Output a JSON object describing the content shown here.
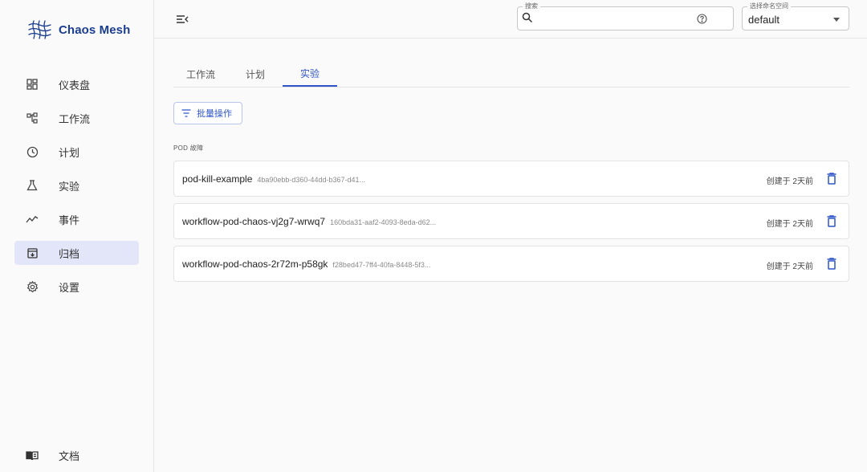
{
  "app": {
    "name": "Chaos Mesh"
  },
  "sidebar": {
    "items": [
      {
        "label": "仪表盘",
        "icon": "dashboard-icon"
      },
      {
        "label": "工作流",
        "icon": "workflow-icon"
      },
      {
        "label": "计划",
        "icon": "schedule-icon"
      },
      {
        "label": "实验",
        "icon": "experiment-icon"
      },
      {
        "label": "事件",
        "icon": "events-icon"
      },
      {
        "label": "归档",
        "icon": "archive-icon",
        "active": true
      },
      {
        "label": "设置",
        "icon": "settings-icon"
      }
    ],
    "docs": {
      "label": "文档",
      "icon": "docs-icon"
    }
  },
  "topbar": {
    "search": {
      "legend": "搜索",
      "placeholder": ""
    },
    "namespace": {
      "legend": "选择命名空间",
      "value": "default"
    }
  },
  "tabs": [
    {
      "label": "工作流"
    },
    {
      "label": "计划"
    },
    {
      "label": "实验",
      "active": true
    }
  ],
  "batch_button": {
    "label": "批量操作"
  },
  "section": {
    "title": "POD 故障"
  },
  "rows": [
    {
      "name": "pod-kill-example",
      "uid": "4ba90ebb-d360-44dd-b367-d41...",
      "created": "创建于 2天前"
    },
    {
      "name": "workflow-pod-chaos-vj2g7-wrwq7",
      "uid": "160bda31-aaf2-4093-8eda-d62...",
      "created": "创建于 2天前"
    },
    {
      "name": "workflow-pod-chaos-2r72m-p58gk",
      "uid": "f28bed47-7ff4-40fa-8448-5f3...",
      "created": "创建于 2天前"
    }
  ],
  "colors": {
    "accent": "#2f55c9",
    "brand": "#1a3d8f",
    "active_bg": "#e3e6f8"
  }
}
